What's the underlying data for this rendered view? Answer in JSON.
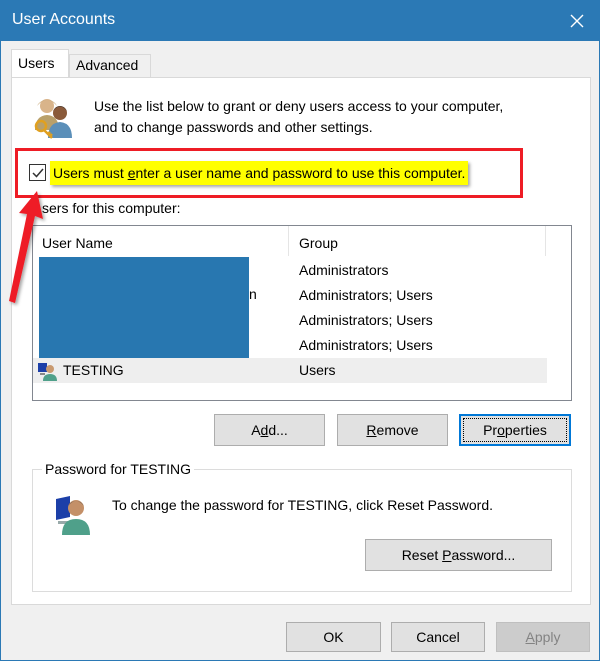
{
  "window": {
    "title": "User Accounts",
    "close_icon": "close-icon"
  },
  "tabs": [
    {
      "label": "Users",
      "active": true
    },
    {
      "label": "Advanced",
      "active": false
    }
  ],
  "intro": {
    "icon": "users-key-icon",
    "text_line1": "Use the list below to grant or deny users access to your computer,",
    "text_line2": "and to change passwords and other settings."
  },
  "require_password": {
    "checked": true,
    "label_pre": "Users must ",
    "label_accel": "e",
    "label_post": "nter a user name and password to use this computer."
  },
  "users_list": {
    "label": "Users for this computer:",
    "label_visible": "sers for this computer:",
    "columns": [
      "User Name",
      "Group"
    ],
    "rows": [
      {
        "name": "",
        "group": "Administrators",
        "redacted": true
      },
      {
        "name": "",
        "group": "Administrators; Users",
        "redacted": true
      },
      {
        "name": "",
        "group": "Administrators; Users",
        "redacted": true
      },
      {
        "name": "",
        "group": "Administrators; Users",
        "redacted": true
      },
      {
        "name": "TESTING",
        "group": "Users",
        "redacted": false,
        "selected": true
      }
    ],
    "redact_tail_char": "n",
    "redaction_color": "#2877b0"
  },
  "user_buttons": {
    "add": {
      "pre": "A",
      "accel": "d",
      "post": "d..."
    },
    "remove": {
      "pre": "",
      "accel": "R",
      "post": "emove"
    },
    "properties": {
      "pre": "Pr",
      "accel": "o",
      "post": "perties"
    }
  },
  "password_group": {
    "title": "Password for TESTING",
    "text": "To change the password for TESTING, click Reset Password.",
    "reset_button": {
      "pre": "Reset ",
      "accel": "P",
      "post": "assword..."
    }
  },
  "footer_buttons": {
    "ok": "OK",
    "cancel": "Cancel",
    "apply": {
      "pre": "",
      "accel": "A",
      "post": "pply",
      "disabled": true
    }
  },
  "annotation": {
    "highlight_color": "#ee1c25",
    "label_highlight_color": "#ffff00"
  }
}
